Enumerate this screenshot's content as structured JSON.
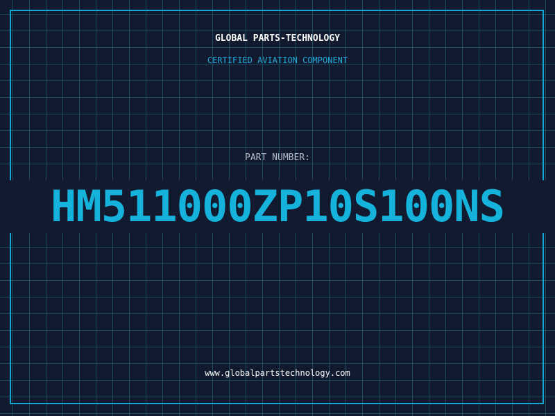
{
  "header": {
    "company": "GLOBAL PARTS-TECHNOLOGY",
    "subtitle": "CERTIFIED AVIATION COMPONENT"
  },
  "part": {
    "label": "PART NUMBER:",
    "number": "HM511000ZP10S100NS"
  },
  "footer": {
    "url": "www.globalpartstechnology.com"
  },
  "colors": {
    "background": "#111a2e",
    "grid": "#1e4a62",
    "accent": "#15b3dc",
    "frame": "#12a7cf"
  }
}
